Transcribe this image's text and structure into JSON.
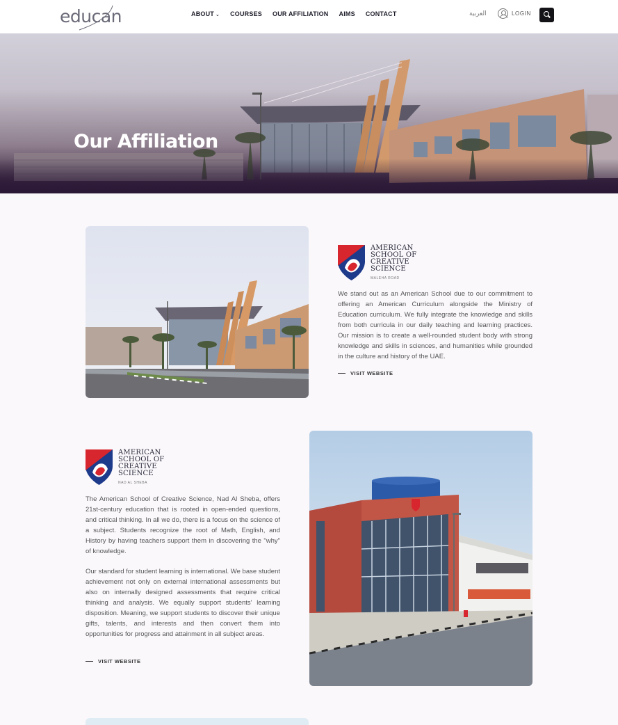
{
  "header": {
    "logo_text": "educan",
    "nav": [
      {
        "label": "ABOUT",
        "has_dropdown": true
      },
      {
        "label": "COURSES"
      },
      {
        "label": "OUR AFFILIATION"
      },
      {
        "label": "AIMS"
      },
      {
        "label": "CONTACT"
      }
    ],
    "language": "العربية",
    "login_label": "LOGIN",
    "icons": {
      "login": "user-circle-icon",
      "search": "search-icon",
      "dropdown": "chevron-down-icon"
    }
  },
  "hero": {
    "title": "Our Affiliation"
  },
  "affiliations": [
    {
      "logo_lines": [
        "AMERICAN",
        "SCHOOL OF",
        "CREATIVE",
        "SCIENCE"
      ],
      "logo_sub": "MALEHA ROAD",
      "paragraphs": [
        "We stand out as an American School due to our commitment to offering an American Curriculum alongside the Ministry of Education curriculum. We fully integrate the knowledge and skills from both curricula in our daily teaching and learning practices. Our mission is to create a well-rounded student body with strong knowledge and skills in sciences, and humanities while grounded in the culture and history of the UAE."
      ],
      "link_label": "VISIT WEBSITE"
    },
    {
      "logo_lines": [
        "AMERICAN",
        "SCHOOL OF",
        "CREATIVE",
        "SCIENCE"
      ],
      "logo_sub": "NAD AL SHEBA",
      "paragraphs": [
        "The American School of Creative Science, Nad Al Sheba, offers 21st-century education that is rooted in open-ended questions, and critical thinking. In all we do, there is a focus on the science of a subject. Students recognize the root of Math, English, and History by having teachers support them in discovering the \"why\" of knowledge.",
        "Our standard for student learning is international. We base student achievement not only on external international assessments but also on internally designed assessments that require critical thinking and analysis. We equally support students' learning disposition. Meaning, we support students to discover their unique gifts, talents, and interests and then convert them into opportunities for progress and attainment in all subject areas."
      ],
      "link_label": "VISIT WEBSITE"
    }
  ],
  "colors": {
    "accent_dark": "#141418",
    "shield_red": "#d8262e",
    "shield_blue": "#1e3a8a",
    "hero_overlay": "#2a1836"
  }
}
